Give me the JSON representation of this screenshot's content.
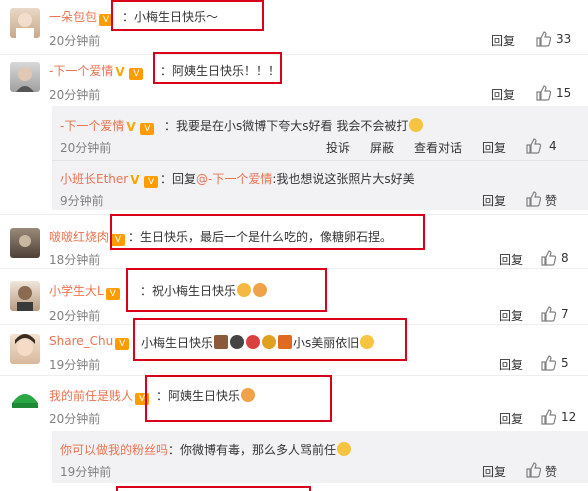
{
  "comments": [
    {
      "name": "一朵包包",
      "text": "：小梅生日快乐～",
      "time": "20分钟前",
      "reply": "回复",
      "likes": "33"
    },
    {
      "name": "-下一个爱情",
      "text": "：阿姨生日快乐！！！",
      "time": "20分钟前",
      "reply": "回复",
      "likes": "15"
    },
    {
      "name": "啵啵红烧肉",
      "text": "：生日快乐，最后一个是什么吃的，像糖卵石捏。",
      "time": "18分钟前",
      "reply": "回复",
      "likes": "8"
    },
    {
      "name": "小学生大L",
      "text": "：祝小梅生日快乐",
      "time": "20分钟前",
      "reply": "回复",
      "likes": "7"
    },
    {
      "name": "Share_Chu",
      "text": "小梅生日快乐",
      "text2": "小s美丽依旧",
      "time": "19分钟前",
      "reply": "回复",
      "likes": "5"
    },
    {
      "name": "我的前任是贱人",
      "text": "：阿姨生日快乐",
      "time": "20分钟前",
      "reply": "回复",
      "likes": "12"
    }
  ],
  "subreplies_1": [
    {
      "name": "-下一个爱情",
      "text": "：我要是在小s微博下夸大s好看 我会不会被打",
      "time": "20分钟前",
      "actions": [
        "投诉",
        "屏蔽",
        "查看对话",
        "回复"
      ],
      "likes": "4"
    },
    {
      "name": "小班长Ether",
      "prefix": "：回复",
      "mention": "@-下一个爱情",
      "text": ":我也想说这张照片大s好美",
      "time": "9分钟前",
      "reply": "回复",
      "likes": "赞"
    }
  ],
  "subreplies_6": [
    {
      "name": "你可以做我的粉丝吗",
      "text": "：你微博有毒，那么多人骂前任",
      "time": "19分钟前",
      "reply": "回复",
      "likes": "赞"
    }
  ],
  "colors": {
    "name": "#eb7350",
    "highlight": "#d9001b",
    "muted": "#808080"
  }
}
